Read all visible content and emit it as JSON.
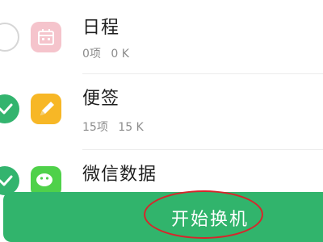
{
  "items": [
    {
      "title": "日程",
      "count": "0项",
      "size": "0 K",
      "checked": false,
      "icon": "calendar-icon"
    },
    {
      "title": "便签",
      "count": "15项",
      "size": "15 K",
      "checked": true,
      "icon": "pen-icon"
    },
    {
      "title": "微信数据",
      "checked": true,
      "icon": "wechat-icon"
    }
  ],
  "start_button": {
    "label": "开始换机"
  },
  "colors": {
    "accent_green": "#31b46c",
    "check_green": "#33b46e",
    "annotation_red": "#d8252b"
  }
}
